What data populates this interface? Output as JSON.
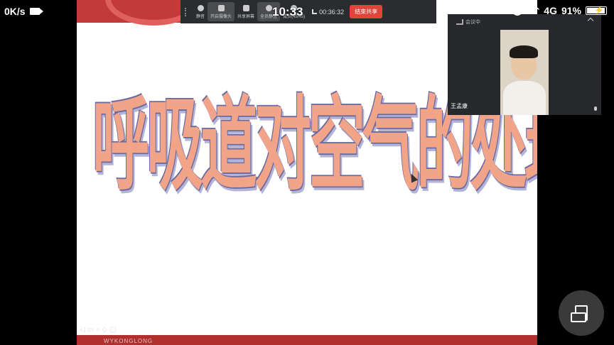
{
  "status_bar": {
    "net_speed": "0K/s",
    "time": "10:33",
    "network": "4G",
    "battery": "91%"
  },
  "slide": {
    "title": "呼吸道对空气的处理",
    "footer_text": "WYKONGLONG"
  },
  "toolbar": {
    "buttons": [
      {
        "label": "静音",
        "icon": "mic-icon"
      },
      {
        "label": "开启摄像头",
        "icon": "camera-icon"
      },
      {
        "label": "共享屏幕",
        "icon": "share-icon"
      },
      {
        "label": "全员静音",
        "icon": "mute-all-icon"
      },
      {
        "label": "成员(45/45)",
        "icon": "members-icon"
      }
    ],
    "timer": "00:36:32",
    "end_share_label": "结束共享"
  },
  "video_panel": {
    "status": "会议中",
    "participant_name": "王孟康"
  },
  "colors": {
    "slide_accent": "#c23a3a",
    "title_fill": "#f2a489",
    "end_button": "#e0443a"
  }
}
